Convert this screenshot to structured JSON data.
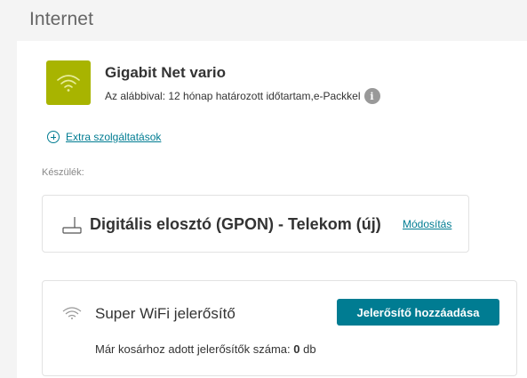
{
  "section": {
    "title": "Internet"
  },
  "package": {
    "icon": "wifi-icon",
    "icon_bg": "#a8b400",
    "name": "Gigabit Net vario",
    "subtitle": "Az alábbival: 12 hónap határozott időtartam,e-Packkel",
    "info_icon": "info-icon",
    "info_glyph": "i"
  },
  "extras": {
    "label": "Extra szolgáltatások",
    "icon": "plus-circle-icon"
  },
  "device": {
    "label": "Készülék:",
    "icon": "router-icon",
    "name": "Digitális elosztó (GPON) - Telekom (új)",
    "modify_label": "Módosítás"
  },
  "repeater": {
    "icon": "wifi-icon",
    "title": "Super WiFi jelerősítő",
    "add_button_label": "Jelerősítő hozzáadása",
    "count_text": "Már kosárhoz adott jelerősítők száma:",
    "count_value": "0",
    "count_unit": "db"
  },
  "colors": {
    "accent": "#007c92",
    "package_green": "#a8b400"
  }
}
